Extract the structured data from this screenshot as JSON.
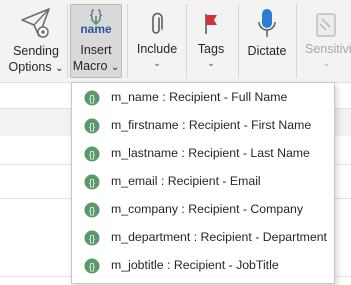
{
  "ribbon": {
    "sending_options": {
      "line1": "Sending",
      "line2": "Options",
      "chevron": "⌄"
    },
    "insert_macro": {
      "line1": "Insert",
      "line2": "Macro",
      "chevron": "⌄",
      "icon_text": "name"
    },
    "include": {
      "label": "Include",
      "chevron": "⌄"
    },
    "tags": {
      "label": "Tags",
      "chevron": "⌄"
    },
    "dictate": {
      "label": "Dictate"
    },
    "sensitivity": {
      "label": "Sensitivi",
      "chevron": "⌄"
    }
  },
  "macro_menu": {
    "items": [
      {
        "label": "m_name : Recipient - Full Name"
      },
      {
        "label": "m_firstname : Recipient - First Name"
      },
      {
        "label": "m_lastname : Recipient - Last Name"
      },
      {
        "label": "m_email : Recipient - Email"
      },
      {
        "label": "m_company : Recipient - Company"
      },
      {
        "label": "m_department : Recipient - Department"
      },
      {
        "label": "m_jobtitle : Recipient - JobTitle"
      }
    ]
  },
  "colors": {
    "accent": "#2b579a",
    "macro_icon_green": "#5b9a68",
    "tag_red": "#d13438"
  }
}
